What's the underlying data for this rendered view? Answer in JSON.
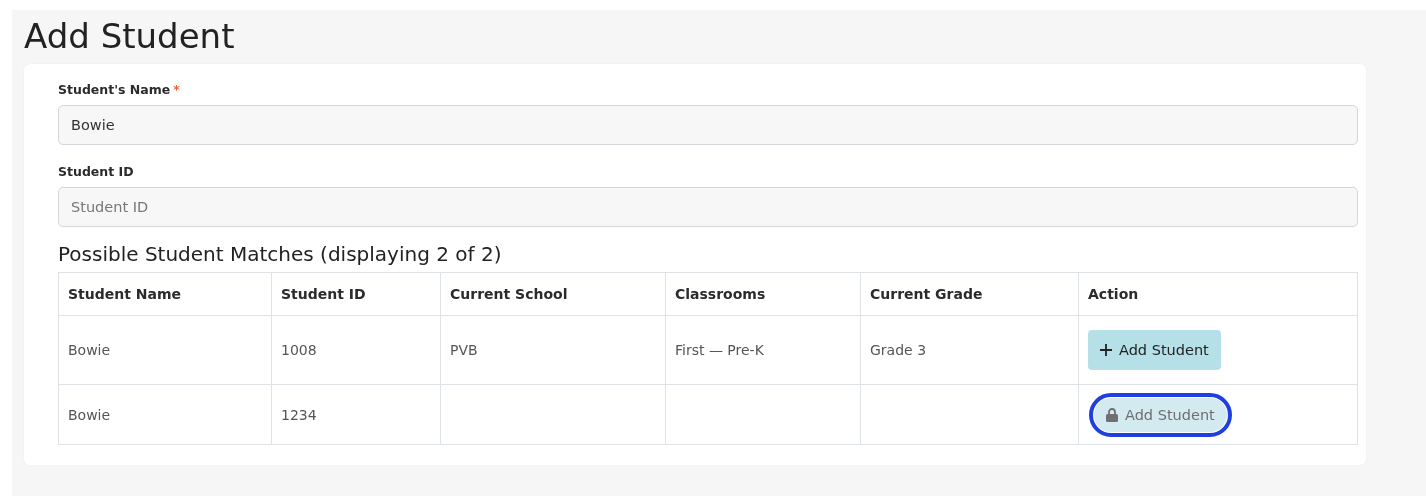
{
  "page_title": "Add Student",
  "fields": [
    {
      "label": "Student's Name",
      "required_mark": "*",
      "value": "Bowie"
    },
    {
      "label": "Student ID",
      "placeholder": "Student ID"
    }
  ],
  "matches": {
    "title": "Possible Student Matches (displaying 2 of 2)",
    "columns": [
      "Student Name",
      "Student ID",
      "Current School",
      "Classrooms",
      "Current Grade",
      "Action"
    ],
    "rows": [
      {
        "cells": [
          "Bowie",
          "1008",
          "PVB",
          "First — Pre-K",
          "Grade 3"
        ],
        "action": {
          "label": "Add Student",
          "disabled": false,
          "focused": false
        }
      },
      {
        "cells": [
          "Bowie",
          "1234",
          "",
          "",
          ""
        ],
        "action": {
          "label": "Add Student",
          "disabled": true,
          "focused": true
        }
      }
    ]
  }
}
